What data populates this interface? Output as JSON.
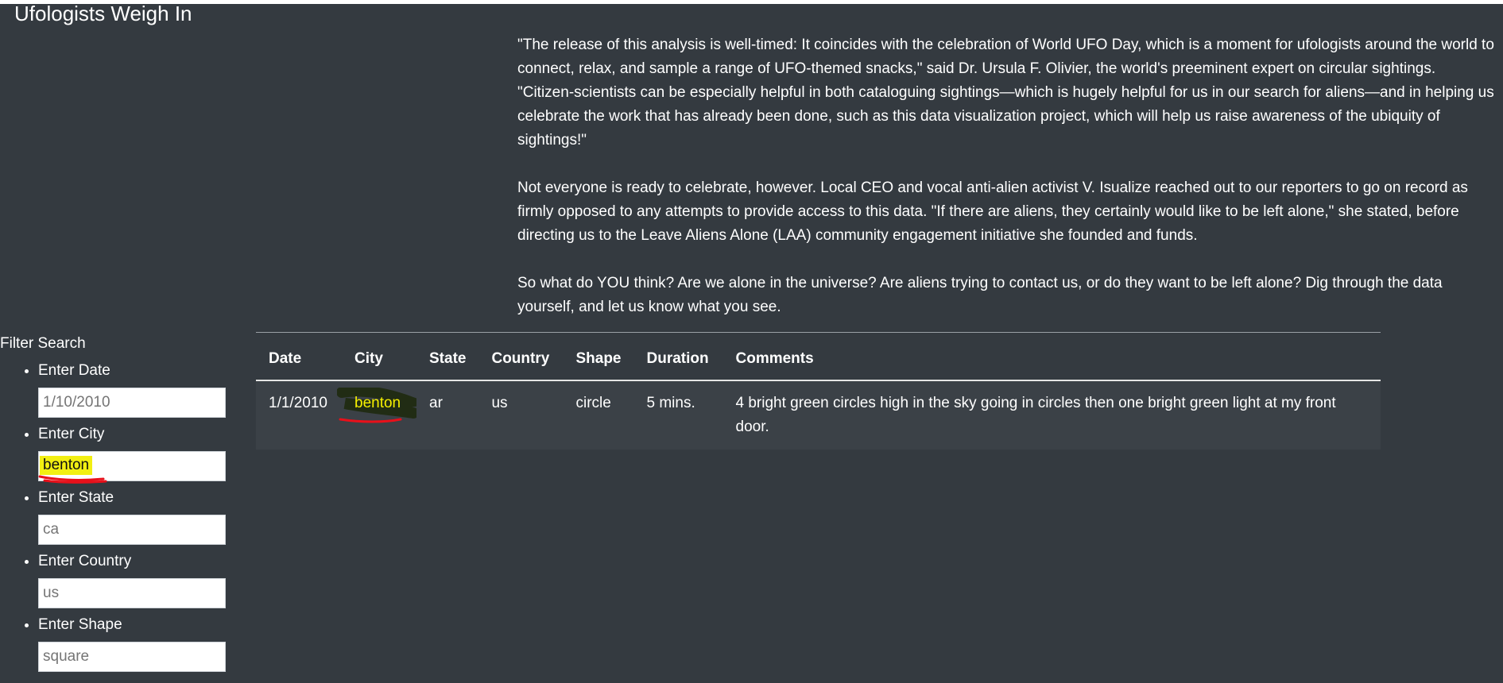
{
  "page": {
    "heading": "Ufologists Weigh In"
  },
  "article": {
    "paragraphs": [
      "\"The release of this analysis is well-timed: It coincides with the celebration of World UFO Day, which is a moment for ufologists around the world to connect, relax, and sample a range of UFO-themed snacks,\" said Dr. Ursula F. Olivier, the world's preeminent expert on circular sightings. \"Citizen-scientists can be especially helpful in both cataloguing sightings—which is hugely helpful for us in our search for aliens—and in helping us celebrate the work that has already been done, such as this data visualization project, which will help us raise awareness of the ubiquity of sightings!\"",
      "Not everyone is ready to celebrate, however. Local CEO and vocal anti-alien activist V. Isualize reached out to our reporters to go on record as firmly opposed to any attempts to provide access to this data. \"If there are aliens, they certainly would like to be left alone,\" she stated, before directing us to the Leave Aliens Alone (LAA) community engagement initiative she founded and funds.",
      "So what do YOU think? Are we alone in the universe? Are aliens trying to contact us, or do they want to be left alone? Dig through the data yourself, and let us know what you see."
    ]
  },
  "filter": {
    "title": "Filter Search",
    "date": {
      "label": "Enter Date",
      "placeholder": "1/10/2010",
      "value": ""
    },
    "city": {
      "label": "Enter City",
      "placeholder": "",
      "value": "benton"
    },
    "state": {
      "label": "Enter State",
      "placeholder": "ca",
      "value": ""
    },
    "country": {
      "label": "Enter Country",
      "placeholder": "us",
      "value": ""
    },
    "shape": {
      "label": "Enter Shape",
      "placeholder": "square",
      "value": ""
    }
  },
  "table": {
    "columns": [
      "Date",
      "City",
      "State",
      "Country",
      "Shape",
      "Duration",
      "Comments"
    ],
    "rows": [
      {
        "date": "1/1/2010",
        "city": "benton",
        "state": "ar",
        "country": "us",
        "shape": "circle",
        "duration": "5 mins.",
        "comments": "4 bright green circles high in the sky going in circles then one bright green light at my front door."
      }
    ]
  },
  "colors": {
    "background": "#343a40",
    "highlight_yellow": "#f2ef12",
    "annotation_red": "#e8101a",
    "annotation_scribble": "#1f2a0e"
  }
}
